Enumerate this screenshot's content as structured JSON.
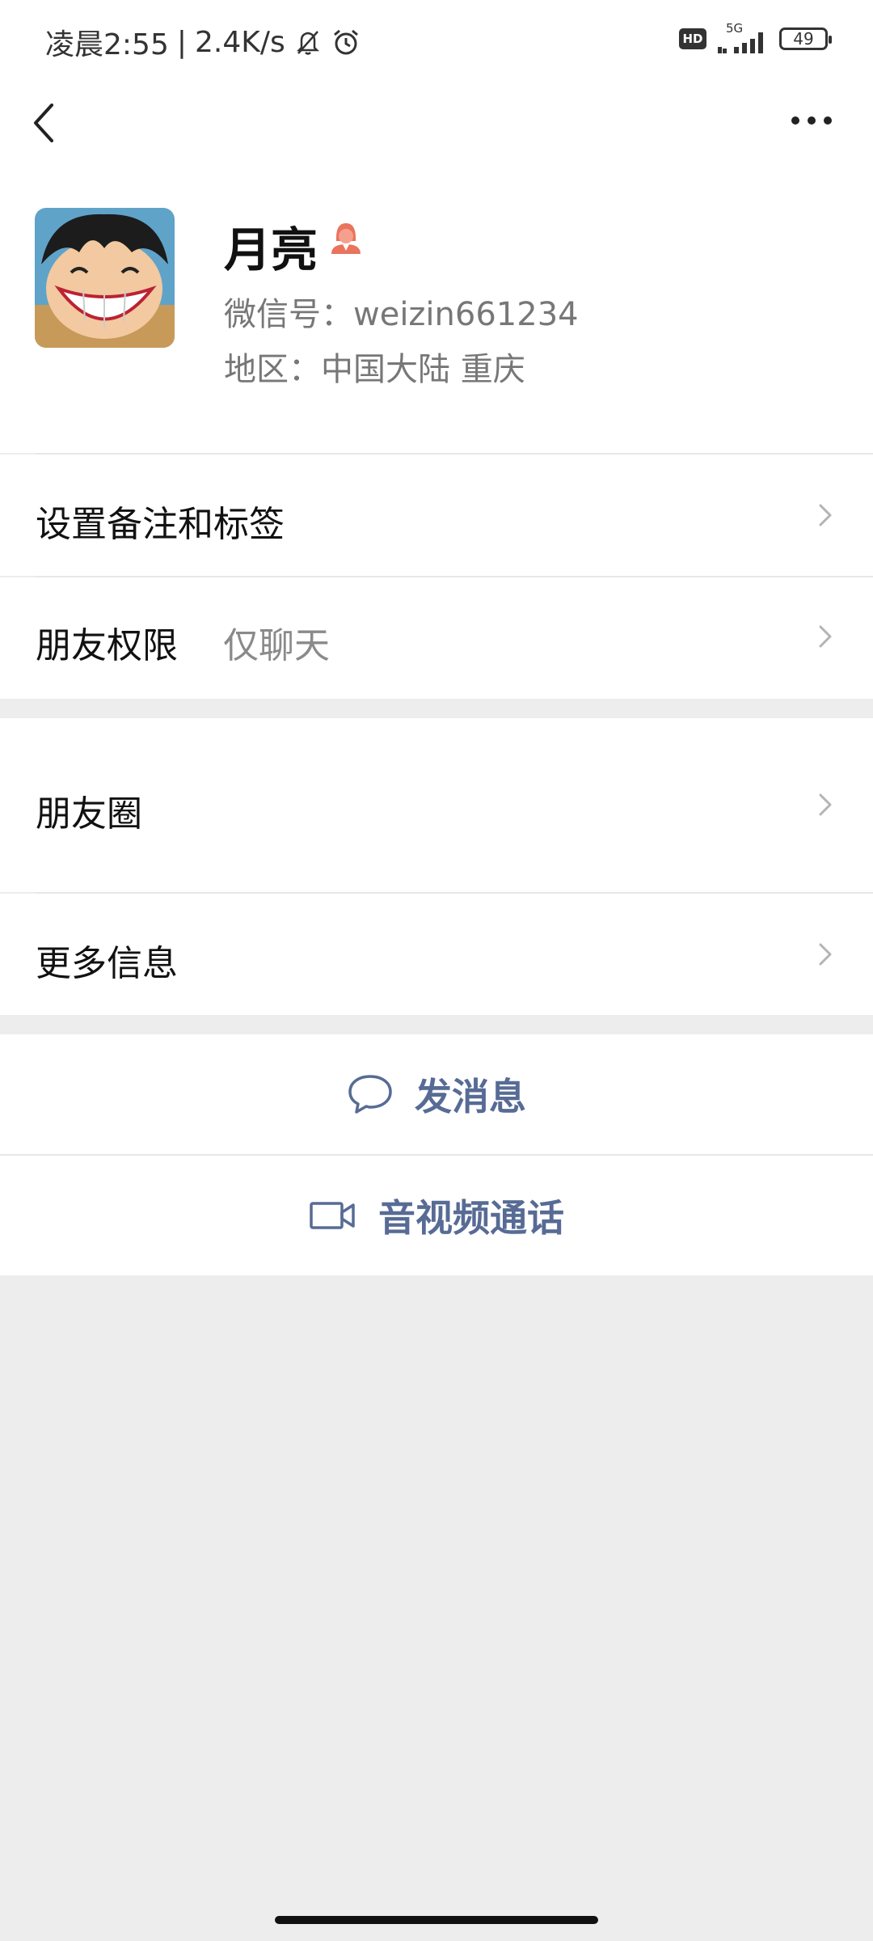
{
  "status_bar": {
    "time": "凌晨2:55",
    "speed": "2.4K/s",
    "network": "5G",
    "hd": "HD",
    "battery": "49"
  },
  "icons": {
    "back": "chevron-left-icon",
    "more": "more-dots-icon",
    "gender": "female-icon",
    "message": "chat-bubble-icon",
    "video": "video-camera-icon"
  },
  "profile": {
    "name": "月亮",
    "wechat_id": "微信号：weizin661234",
    "region": "地区：中国大陆  重庆"
  },
  "rows": {
    "remark_tags": "设置备注和标签",
    "friend_permission_label": "朋友权限",
    "friend_permission_value": "仅聊天",
    "moments": "朋友圈",
    "more_info": "更多信息"
  },
  "actions": {
    "send_message": "发消息",
    "av_call": "音视频通话"
  },
  "colors": {
    "accent": "#576b95",
    "gender_icon": "#e9735d",
    "background": "#ededed"
  }
}
